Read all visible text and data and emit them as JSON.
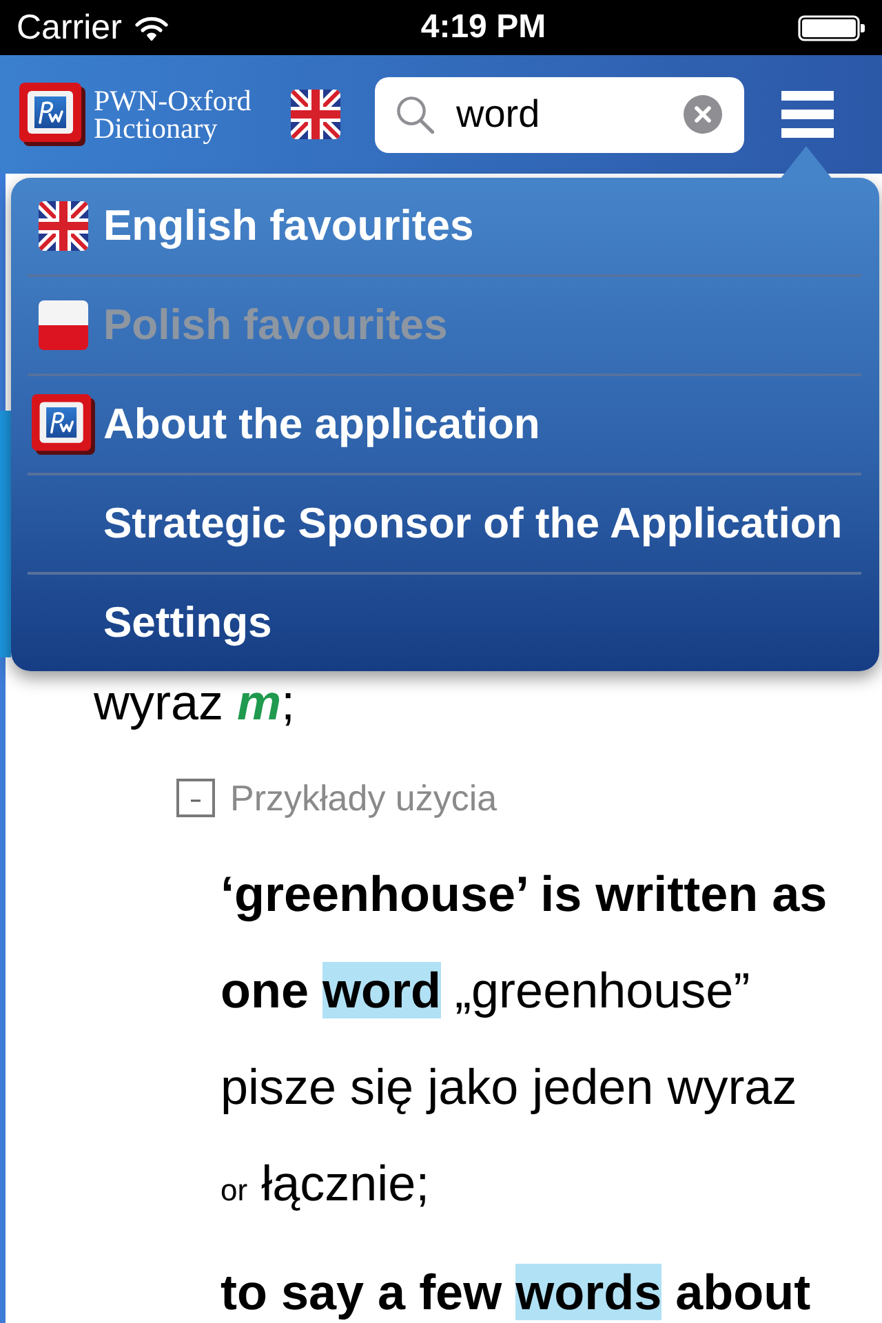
{
  "status_bar": {
    "carrier": "Carrier",
    "time": "4:19 PM"
  },
  "header": {
    "title": "PWN-Oxford Dictionary",
    "search": {
      "value": "word"
    }
  },
  "menu": {
    "items": [
      {
        "kind": "english",
        "label": "English favourites",
        "disabled": false
      },
      {
        "kind": "polish",
        "label": "Polish favourites",
        "disabled": true
      },
      {
        "kind": "app",
        "label": "About the application",
        "disabled": false
      },
      {
        "kind": "plain",
        "label": "Strategic Sponsor of the Application",
        "disabled": false
      },
      {
        "kind": "plain",
        "label": "Settings",
        "disabled": false
      }
    ]
  },
  "entry": {
    "translation": "wyraz",
    "gender": "m",
    "end": ";"
  },
  "examples": {
    "expanded": true,
    "heading": "Przykłady użycia",
    "items": [
      {
        "segments": [
          {
            "kind": "source",
            "text": "‘greenhouse’ is written as one",
            "highlighted": false
          },
          {
            "kind": "source",
            "text": "word",
            "highlighted": true
          },
          {
            "kind": "translation",
            "text": "„greenhouse” pisze się jako jeden wyraz",
            "highlighted": false
          },
          {
            "kind": "label",
            "text": "or",
            "highlighted": false
          },
          {
            "kind": "translation",
            "text": "łącznie;",
            "highlighted": false
          }
        ]
      },
      {
        "segments": [
          {
            "kind": "source",
            "text": "to say a few",
            "highlighted": false
          },
          {
            "kind": "source",
            "text": "words",
            "highlighted": true
          },
          {
            "kind": "source",
            "text": "about",
            "highlighted": false
          }
        ]
      }
    ]
  }
}
